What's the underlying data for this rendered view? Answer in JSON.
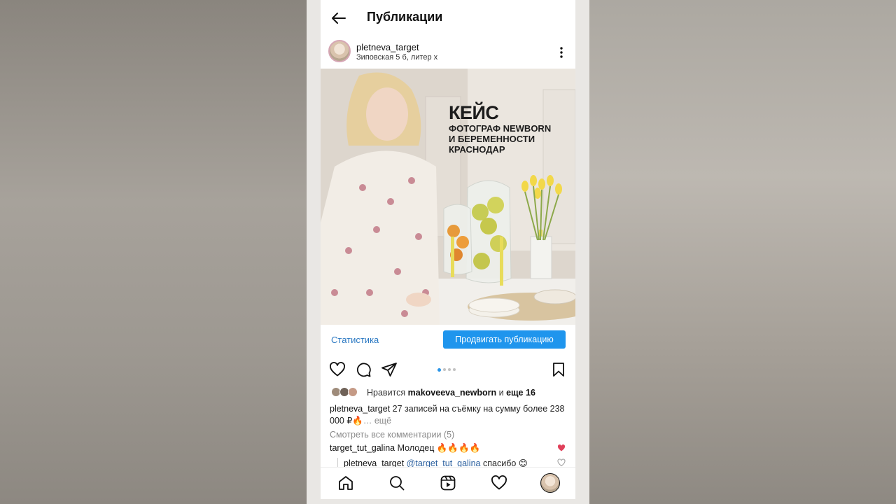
{
  "header": {
    "title": "Публикации"
  },
  "post": {
    "username": "pletneva_target",
    "location": "Зиповская 5 б, литер х",
    "image": {
      "title": "КЕЙС",
      "subtitle": "ФОТОГРАФ NEWBORN\nИ БЕРЕМЕННОСТИ\nКРАСНОДАР"
    },
    "stats_link": "Статистика",
    "promote_button": "Продвигать публикацию",
    "carousel": {
      "count": 4,
      "active": 1
    },
    "likes": {
      "prefix": "Нравится",
      "user": "makoveeva_newborn",
      "joiner": "и",
      "others": "еще 16"
    },
    "caption": {
      "username": "pletneva_target",
      "text": "27 записей на съёмку на сумму более 238 000 ₽🔥",
      "more": "… ещё"
    },
    "view_comments": "Смотреть все комментарии (5)",
    "comments": [
      {
        "username": "target_tut_galina",
        "text": "Молодец 🔥🔥🔥🔥",
        "liked": true
      },
      {
        "username": "pletneva_target",
        "mention": "@target_tut_galina",
        "text": "спасибо 😊",
        "liked": false
      }
    ]
  },
  "colors": {
    "accent": "#1f95ed",
    "link": "#2a78c2",
    "like": "#e0405a"
  },
  "icons": {
    "back": "arrow-left-icon",
    "more": "more-vertical-icon",
    "like": "heart-icon",
    "comment": "comment-icon",
    "share": "send-icon",
    "save": "bookmark-icon",
    "nav": [
      "home-icon",
      "search-icon",
      "reels-icon",
      "heart-icon",
      "profile-avatar"
    ]
  }
}
